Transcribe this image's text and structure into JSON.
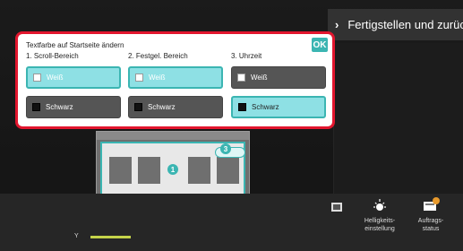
{
  "header": {
    "finish_label": "Fertigstellen und zurück"
  },
  "dialog": {
    "title": "Textfarbe auf Startseite ändern",
    "ok_label": "OK",
    "columns": [
      {
        "label": "1. Scroll-Bereich",
        "options": [
          {
            "label": "Weiß",
            "selected": true
          },
          {
            "label": "Schwarz",
            "selected": false
          }
        ]
      },
      {
        "label": "2. Festgel. Bereich",
        "options": [
          {
            "label": "Weiß",
            "selected": true
          },
          {
            "label": "Schwarz",
            "selected": false
          }
        ]
      },
      {
        "label": "3. Uhrzeit",
        "options": [
          {
            "label": "Weiß",
            "selected": false
          },
          {
            "label": "Schwarz",
            "selected": true
          }
        ]
      }
    ]
  },
  "preview": {
    "badges": [
      "1",
      "2",
      "3"
    ]
  },
  "bottom": {
    "y_label": "Y",
    "brightness_label_1": "Helligkeits-",
    "brightness_label_2": "einstellung",
    "job_label_1": "Auftrags-",
    "job_label_2": "status"
  },
  "colors": {
    "accent": "#3bb5b2",
    "highlight_border": "#e2162e",
    "selected_fill": "#8ee0e4"
  }
}
